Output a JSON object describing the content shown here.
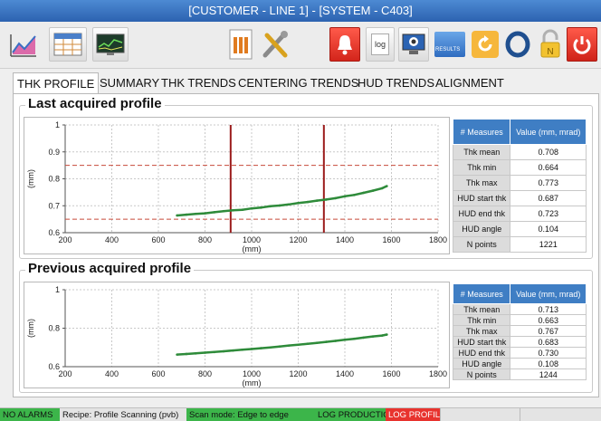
{
  "window": {
    "title": "[CUSTOMER - LINE 1] - [SYSTEM - C403]"
  },
  "toolbar": {
    "buttons": [
      {
        "icon": "line-chart-icon"
      },
      {
        "icon": "table-icon"
      },
      {
        "icon": "monitor-trend-icon"
      },
      {
        "icon": "report-icon"
      },
      {
        "icon": "tools-icon"
      },
      {
        "icon": "alarm-bell-icon"
      },
      {
        "icon": "log-icon",
        "label": "log"
      },
      {
        "icon": "camera-monitor-icon"
      },
      {
        "icon": "results-folder-icon",
        "label": "RESULTS"
      },
      {
        "icon": "refresh-icon"
      },
      {
        "icon": "ring-icon"
      },
      {
        "icon": "lock-icon"
      },
      {
        "icon": "power-icon"
      }
    ]
  },
  "tabs": [
    "THK PROFILE",
    "SUMMARY",
    "THK TRENDS",
    "CENTERING TRENDS",
    "HUD TRENDS",
    "ALIGNMENT"
  ],
  "active_tab": "THK PROFILE",
  "last_profile": {
    "title": "Last acquired profile",
    "table": {
      "headers": [
        "# Measures",
        "Value (mm, mrad)"
      ],
      "rows": [
        [
          "Thk mean",
          "0.708"
        ],
        [
          "Thk min",
          "0.664"
        ],
        [
          "Thk max",
          "0.773"
        ],
        [
          "HUD start thk",
          "0.687"
        ],
        [
          "HUD end thk",
          "0.723"
        ],
        [
          "HUD angle",
          "0.104"
        ],
        [
          "N points",
          "1221"
        ]
      ]
    }
  },
  "previous_profile": {
    "title": "Previous acquired profile",
    "table": {
      "headers": [
        "# Measures",
        "Value (mm, mrad)"
      ],
      "rows": [
        [
          "Thk mean",
          "0.713"
        ],
        [
          "Thk min",
          "0.663"
        ],
        [
          "Thk max",
          "0.767"
        ],
        [
          "HUD start thk",
          "0.683"
        ],
        [
          "HUD end thk",
          "0.730"
        ],
        [
          "HUD angle",
          "0.108"
        ],
        [
          "N points",
          "1244"
        ]
      ]
    }
  },
  "chart_data": [
    {
      "type": "line",
      "xlabel": "(mm)",
      "ylabel": "(mm)",
      "xlim": [
        200,
        1800
      ],
      "ylim": [
        0.6,
        1.0
      ],
      "x_ticks": [
        "200",
        "400",
        "600",
        "800",
        "1000",
        "1200",
        "1400",
        "1600",
        "1800"
      ],
      "y_ticks": [
        "0.6",
        "0.7",
        "0.8",
        "0.9",
        "1"
      ],
      "grid": true,
      "limit_lines_y": [
        0.65,
        0.85
      ],
      "markers_x": [
        910,
        1310
      ],
      "series": [
        {
          "color": "#2e8b3a",
          "x": [
            680,
            720,
            760,
            800,
            840,
            880,
            920,
            960,
            1000,
            1040,
            1080,
            1120,
            1160,
            1200,
            1240,
            1280,
            1320,
            1360,
            1400,
            1440,
            1480,
            1520,
            1560,
            1580
          ],
          "y": [
            0.664,
            0.667,
            0.67,
            0.672,
            0.676,
            0.68,
            0.683,
            0.685,
            0.69,
            0.693,
            0.698,
            0.701,
            0.705,
            0.71,
            0.714,
            0.719,
            0.723,
            0.728,
            0.735,
            0.74,
            0.748,
            0.756,
            0.765,
            0.773
          ]
        }
      ]
    },
    {
      "type": "line",
      "xlabel": "(mm)",
      "ylabel": "(mm)",
      "xlim": [
        200,
        1800
      ],
      "ylim": [
        0.6,
        1.0
      ],
      "x_ticks": [
        "200",
        "400",
        "600",
        "800",
        "1000",
        "1200",
        "1400",
        "1600",
        "1800"
      ],
      "y_ticks": [
        "0.6",
        "0.8",
        "1"
      ],
      "grid": true,
      "series": [
        {
          "color": "#2e8b3a",
          "x": [
            680,
            720,
            760,
            800,
            840,
            880,
            920,
            960,
            1000,
            1040,
            1080,
            1120,
            1160,
            1200,
            1240,
            1280,
            1320,
            1360,
            1400,
            1440,
            1480,
            1520,
            1560,
            1580
          ],
          "y": [
            0.663,
            0.666,
            0.669,
            0.673,
            0.676,
            0.68,
            0.684,
            0.688,
            0.692,
            0.696,
            0.7,
            0.705,
            0.71,
            0.714,
            0.719,
            0.724,
            0.729,
            0.734,
            0.74,
            0.745,
            0.751,
            0.757,
            0.762,
            0.767
          ]
        }
      ]
    }
  ],
  "status": [
    {
      "text": "NO ALARMS",
      "bg": "#3cb54a"
    },
    {
      "text": "Recipe: Profile Scanning (pvb)",
      "bg": "#e4e4e4"
    },
    {
      "text": "Scan mode: Edge to edge",
      "bg": "#3cb54a"
    },
    {
      "text": "LOG PRODUCTION",
      "bg": "#3cb54a"
    },
    {
      "text": "LOG PROFILE",
      "bg": "#e8332e"
    }
  ]
}
